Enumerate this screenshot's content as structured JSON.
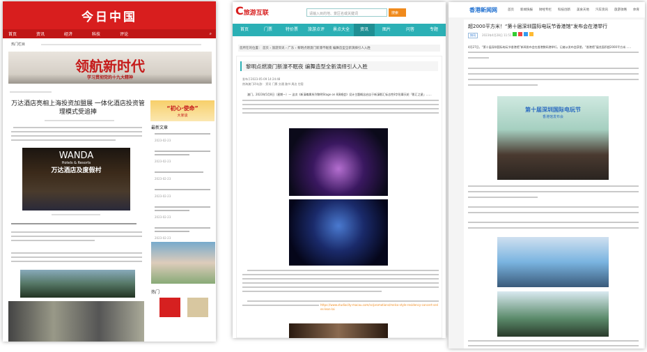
{
  "left": {
    "logo": "今日中国",
    "nav": [
      "首页",
      "资讯",
      "经济",
      "科技",
      "评论"
    ],
    "subnav_label": "热门栏目",
    "banner_title": "领航新时代",
    "banner_sub": "学习贯彻党的十九大精神",
    "title": "万达酒店亮相上海投资加盟展 一体化酒店投资管理模式受追捧",
    "promo": "“初心·使命”",
    "promo_sub": "大家谈",
    "latest_label": "最新文章",
    "latest_dates": [
      "2023-02-23",
      "2023-02-23",
      "2023-02-23",
      "2023-02-23",
      "2023-02-23",
      "2023-02-23"
    ],
    "hot_label": "热门",
    "image_brand": "WANDA",
    "image_brand_sub": "Hotels & Resorts",
    "image_brand_cn": "万达酒店及度假村"
  },
  "middle": {
    "logo": "旅游互联",
    "search_placeholder": "请输入目的地、景区名或关键词",
    "search_button": "搜索",
    "nav": [
      "首页",
      "门票",
      "特价票",
      "旅游点评",
      "景点大全",
      "资讯",
      "图片",
      "问答",
      "专题"
    ],
    "active_nav": "资讯",
    "breadcrumb": [
      "您所在的位置：",
      "首页",
      "旅游资讯",
      "广东",
      "黎明点燃澳门新濠不眠夜 编舞造型全新演绎引人入胜"
    ],
    "title": "黎明点燃澳门新濠不眠夜 编舞造型全新演绎引人入胜",
    "published": "发布于2023-05-09 14:24:48",
    "tags_label": "热海澳门环岛游：",
    "tags": [
      "资讯",
      "门票",
      "交通",
      "路书",
      "周边",
      "住宿"
    ],
    "lead": "澳门，2023年5月8日（星期一）— 这次《新濠尊属系列黎明Stage on 8演唱会》设计主题概念启自于新濠影汇标志性8字形摩天轮「影汇之星」……",
    "link": "https://www.studiocity-macau.com/sc/promotions/melco-style-residency-concert-series-leon-lai"
  },
  "right": {
    "logo": "香港新闻网",
    "nav": [
      "首页",
      "新闻快报",
      "财经专栏",
      "科技创新",
      "美食天地",
      "汽车资讯",
      "旅游攻略",
      "体育"
    ],
    "title": "超2000平方米！“第十届深圳国际电玩节香港馆”发布会在港举行",
    "tag": "快讯",
    "date": "2023年4月28日 11:51",
    "p1": "4月27日，“第十届深圳国际电玩节香港馆”新闻发布会在香港数码港举行，记者从发布会获悉，“香港馆”展览面积超2000平方米……",
    "banner": "第十届深圳国际电玩节",
    "banner_sub": "香港馆发布会"
  },
  "colors": {
    "red": "#d81e1e",
    "teal": "#2bb0b5",
    "orange": "#f08a1c",
    "blue": "#1e6fd0"
  }
}
